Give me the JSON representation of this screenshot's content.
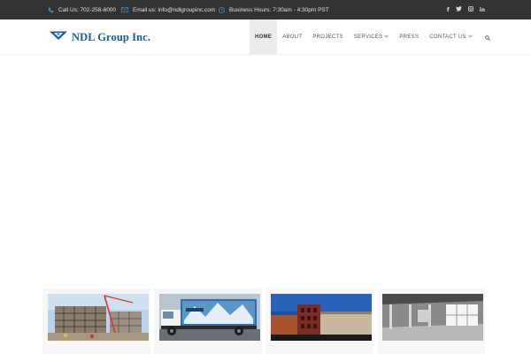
{
  "topbar": {
    "phone": {
      "icon": "phone-icon",
      "text": "Call Us: 702-258-6000"
    },
    "email": {
      "icon": "envelope-icon",
      "text": "Email us: info@ndlgroupinc.com"
    },
    "hours": {
      "icon": "clock-icon",
      "text": "Business Hours: 7:30am - 4:30pm PST"
    },
    "social": [
      "facebook-icon",
      "twitter-icon",
      "instagram-icon",
      "linkedin-icon"
    ]
  },
  "header": {
    "logo_text": "NDL Group Inc.",
    "nav": [
      {
        "label": "HOME",
        "active": true
      },
      {
        "label": "ABOUT"
      },
      {
        "label": "PROJECTS"
      },
      {
        "label": "SERVICES",
        "dropdown": true
      },
      {
        "label": "PRESS"
      },
      {
        "label": "CONTACT US",
        "dropdown": true
      }
    ],
    "search_icon": "search-icon"
  },
  "colors": {
    "topbar_bg": "#333333",
    "accent_blue": "#3a8fd6",
    "logo_blue": "#1d5d93",
    "active_nav_bg": "#ebebeb"
  },
  "cards": [
    {
      "image": "construction-site-photo"
    },
    {
      "image": "box-truck-photo"
    },
    {
      "image": "brick-building-photo"
    },
    {
      "image": "interior-room-photo"
    }
  ]
}
